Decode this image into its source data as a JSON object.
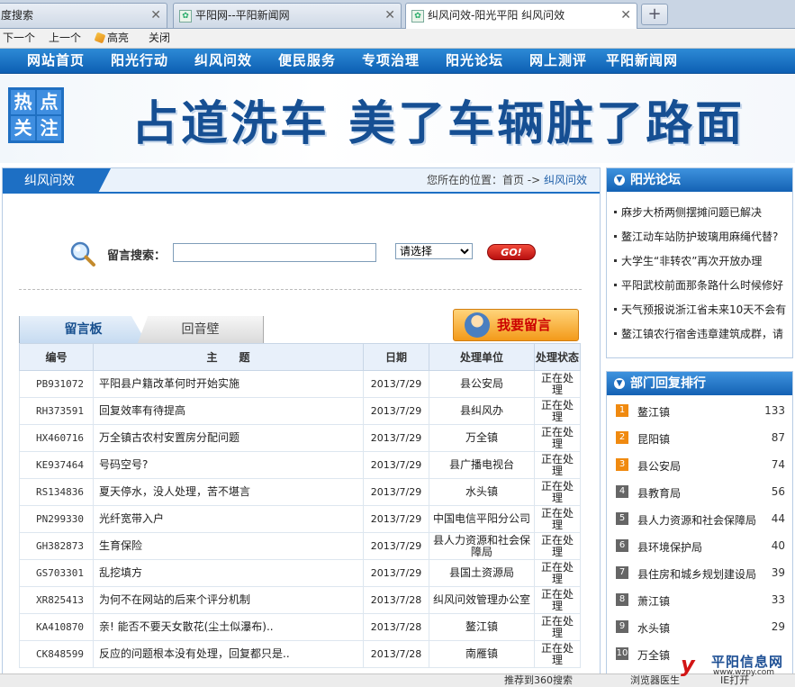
{
  "browser": {
    "tabs": [
      {
        "title": "度搜索",
        "active": false
      },
      {
        "title": "平阳网--平阳新闻网",
        "active": false
      },
      {
        "title": "纠风问效-阳光平阳 纠风问效",
        "active": true
      }
    ],
    "new_tab": "+",
    "find_bar": {
      "next": "下一个",
      "prev": "上一个",
      "highlight": "高亮",
      "close": "关闭"
    }
  },
  "nav": {
    "items": [
      "网站首页",
      "阳光行动",
      "纠风问效",
      "便民服务",
      "专项治理",
      "阳光论坛",
      "网上测评",
      "平阳新闻网"
    ]
  },
  "banner": {
    "badge": [
      "热",
      "点",
      "关",
      "注"
    ],
    "headline": "占道洗车  美了车辆脏了路面"
  },
  "main": {
    "title": "纠风问效",
    "breadcrumb": {
      "prefix": "您所在的位置：",
      "home": "首页",
      "sep": " -> ",
      "current": "纠风问效"
    },
    "search": {
      "label": "留言搜索：",
      "input_value": "",
      "select_value": "请选择",
      "go": "GO!"
    },
    "tabs": {
      "board": "留言板",
      "echo": "回音壁"
    },
    "post_button": "我要留言",
    "table": {
      "headers": [
        "编号",
        "主　　题",
        "日期",
        "处理单位",
        "处理状态"
      ],
      "rows": [
        {
          "id": "PB931072",
          "subject": "平阳县户籍改革何时开始实施",
          "date": "2013/7/29",
          "dept": "县公安局",
          "status": "正在处理"
        },
        {
          "id": "RH373591",
          "subject": "回复效率有待提高",
          "date": "2013/7/29",
          "dept": "县纠风办",
          "status": "正在处理"
        },
        {
          "id": "HX460716",
          "subject": "万全镇古农村安置房分配问题",
          "date": "2013/7/29",
          "dept": "万全镇",
          "status": "正在处理"
        },
        {
          "id": "KE937464",
          "subject": "号码空号?",
          "date": "2013/7/29",
          "dept": "县广播电视台",
          "status": "正在处理"
        },
        {
          "id": "RS134836",
          "subject": "夏天停水，没人处理，苦不堪言",
          "date": "2013/7/29",
          "dept": "水头镇",
          "status": "正在处理"
        },
        {
          "id": "PN299330",
          "subject": "光纤宽带入户",
          "date": "2013/7/29",
          "dept": "中国电信平阳分公司",
          "status": "正在处理"
        },
        {
          "id": "GH382873",
          "subject": "生育保险",
          "date": "2013/7/29",
          "dept": "县人力资源和社会保障局",
          "status": "正在处理"
        },
        {
          "id": "GS703301",
          "subject": "乱挖填方",
          "date": "2013/7/29",
          "dept": "县国土资源局",
          "status": "正在处理"
        },
        {
          "id": "XR825413",
          "subject": "为何不在网站的后来个评分机制",
          "date": "2013/7/28",
          "dept": "纠风问效管理办公室",
          "status": "正在处理"
        },
        {
          "id": "KA410870",
          "subject": "亲! 能否不要天女散花(尘土似瀑布)..",
          "date": "2013/7/28",
          "dept": "鳌江镇",
          "status": "正在处理"
        },
        {
          "id": "CK848599",
          "subject": "反应的问题根本没有处理，回复都只是..",
          "date": "2013/7/28",
          "dept": "南雁镇",
          "status": "正在处理"
        }
      ]
    }
  },
  "forum": {
    "title": "阳光论坛",
    "items": [
      "麻步大桥两侧摆摊问题已解决",
      "鳌江动车站防护玻璃用麻绳代替?",
      "大学生“非转农”再次开放办理",
      "平阳武校前面那条路什么时候修好",
      "天气预报说浙江省未来10天不会有",
      "鳌江镇农行宿舍违章建筑成群，请"
    ]
  },
  "ranking": {
    "title": "部门回复排行",
    "items": [
      {
        "rank": "1",
        "dept": "鳌江镇",
        "count": "133"
      },
      {
        "rank": "2",
        "dept": "昆阳镇",
        "count": "87"
      },
      {
        "rank": "3",
        "dept": "县公安局",
        "count": "74"
      },
      {
        "rank": "4",
        "dept": "县教育局",
        "count": "56"
      },
      {
        "rank": "5",
        "dept": "县人力资源和社会保障局",
        "count": "44"
      },
      {
        "rank": "6",
        "dept": "县环境保护局",
        "count": "40"
      },
      {
        "rank": "7",
        "dept": "县住房和城乡规划建设局",
        "count": "39"
      },
      {
        "rank": "8",
        "dept": "萧江镇",
        "count": "33"
      },
      {
        "rank": "9",
        "dept": "水头镇",
        "count": "29"
      },
      {
        "rank": "10",
        "dept": "万全镇",
        "count": ""
      }
    ]
  },
  "statusbar": {
    "recommend": "推荐到360搜索",
    "doctor": "浏览器医生",
    "ie": "IE打开"
  },
  "logo": {
    "mark": "y",
    "name": "平阳信息网",
    "url": "www.wzpy.com"
  }
}
